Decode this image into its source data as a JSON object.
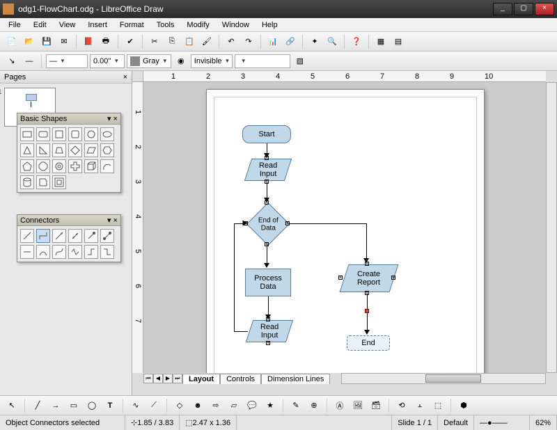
{
  "window": {
    "title": "odg1-FlowChart.odg - LibreOffice Draw",
    "min": "_",
    "max": "▢",
    "close": "×"
  },
  "menu": [
    "File",
    "Edit",
    "View",
    "Insert",
    "Format",
    "Tools",
    "Modify",
    "Window",
    "Help"
  ],
  "toolbar2": {
    "line_width": "0.00\"",
    "color_name": "Gray",
    "line_style": "Invisible"
  },
  "sidebar": {
    "title": "Pages",
    "page_num": "1"
  },
  "palettes": {
    "shapes": {
      "title": "Basic Shapes"
    },
    "connectors": {
      "title": "Connectors"
    }
  },
  "flowchart": {
    "start": "Start",
    "read1": "Read\nInput",
    "decision": "End of\nData",
    "process": "Process\nData",
    "report": "Create\nReport",
    "read2": "Read\nInput",
    "end": "End"
  },
  "view_tabs": [
    "Layout",
    "Controls",
    "Dimension Lines"
  ],
  "ruler_h": [
    "1",
    "2",
    "3",
    "4",
    "5",
    "6",
    "7",
    "8",
    "9",
    "10"
  ],
  "ruler_v": [
    "1",
    "2",
    "3",
    "4",
    "5",
    "6",
    "7"
  ],
  "status": {
    "msg": "Object Connectors selected",
    "pos": "1.85 / 3.83",
    "size": "2.47 x 1.36",
    "slide": "Slide 1 / 1",
    "layout": "Default",
    "zoom": "62%"
  }
}
